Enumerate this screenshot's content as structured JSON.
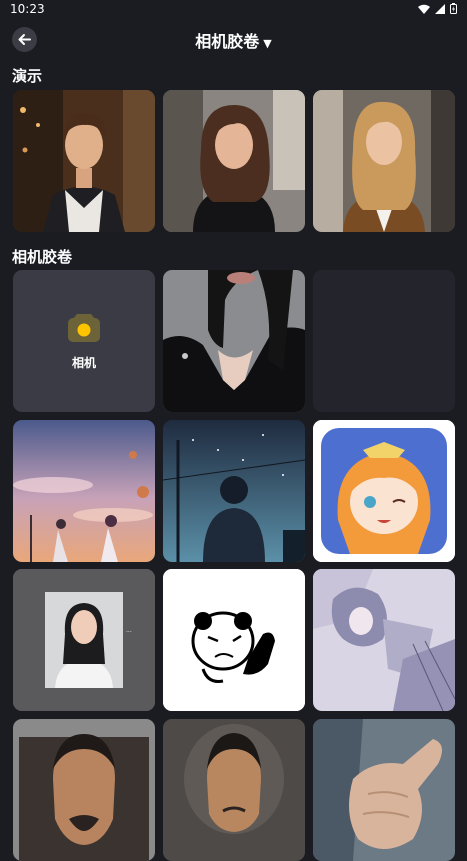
{
  "status": {
    "time": "10:23"
  },
  "header": {
    "title": "相机胶卷"
  },
  "sections": {
    "demo": "演示",
    "roll": "相机胶卷"
  },
  "camera": {
    "label": "相机"
  },
  "colors": {
    "background": "#1b1c22",
    "tile": "#3a3b44",
    "accent": "#ffc400"
  },
  "demo_photos": [
    {
      "name": "young-man-in-bar"
    },
    {
      "name": "woman-dark-hair-street"
    },
    {
      "name": "woman-blonde-brown-jacket"
    }
  ],
  "roll_photos": [
    {
      "name": "woman-black-outfit"
    },
    {
      "name": "empty-slot"
    },
    {
      "name": "anime-sunset-couple"
    },
    {
      "name": "anime-starry-sky-boy"
    },
    {
      "name": "anime-girl-icon"
    },
    {
      "name": "id-photo-woman"
    },
    {
      "name": "panda-meme"
    },
    {
      "name": "anime-girl-sketch"
    },
    {
      "name": "asian-man-portrait-1"
    },
    {
      "name": "asian-man-portrait-2"
    },
    {
      "name": "thumbs-up-hand"
    }
  ]
}
